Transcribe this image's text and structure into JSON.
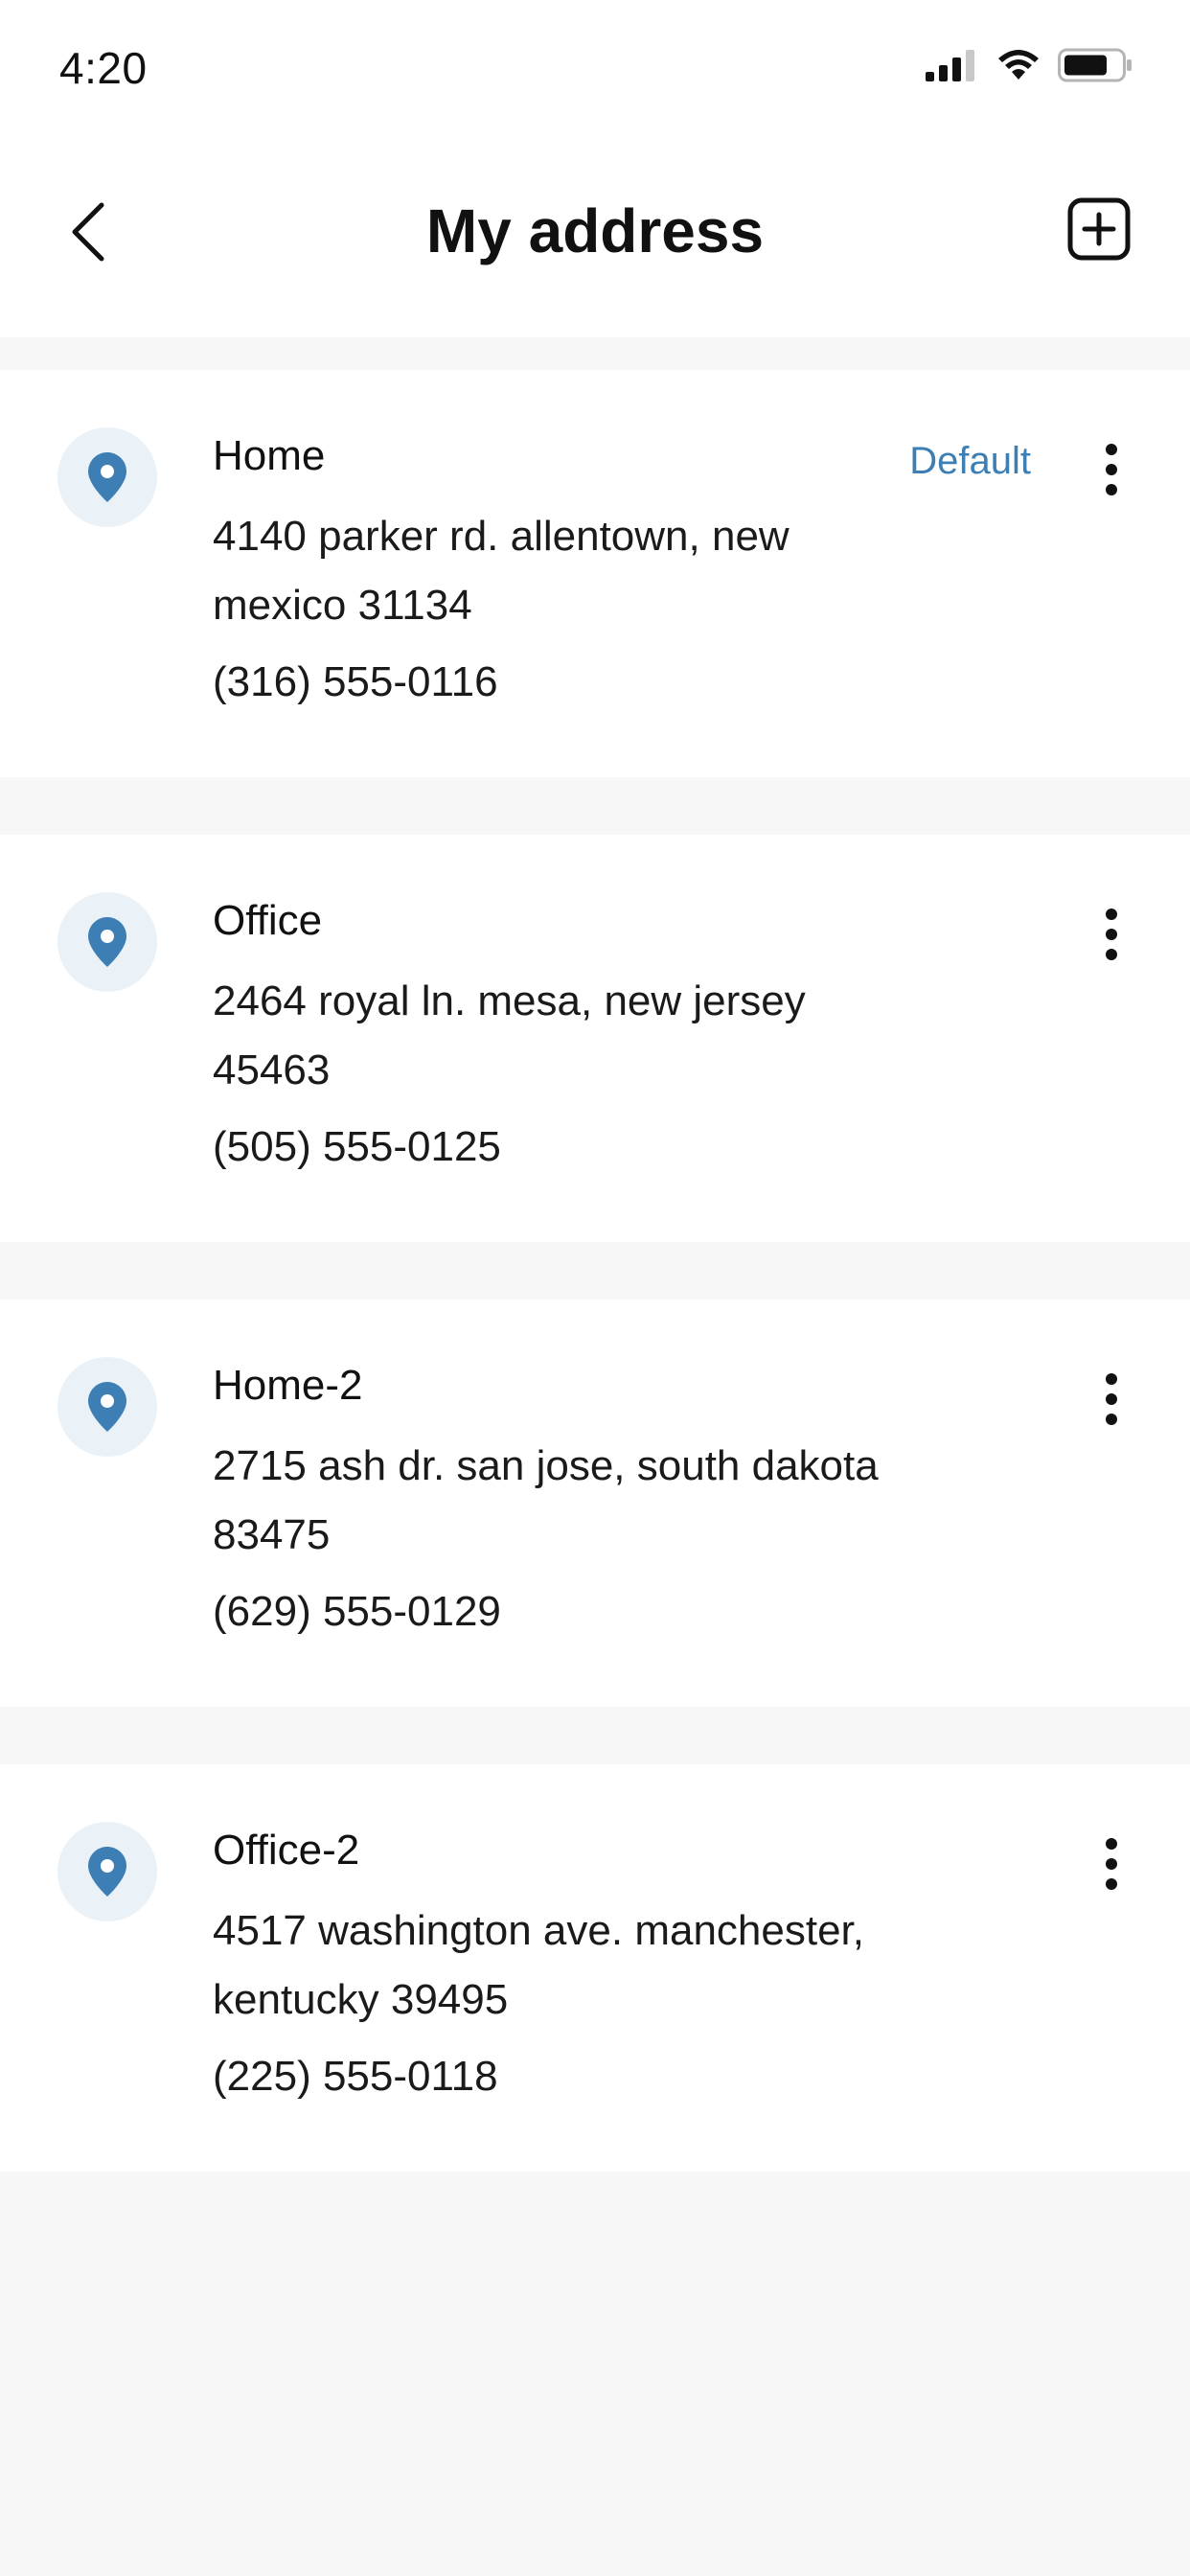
{
  "status_bar": {
    "time": "4:20"
  },
  "header": {
    "title": "My address"
  },
  "colors": {
    "accent": "#3d7fb5",
    "pin_bg": "#eaf1f7",
    "page_bg": "#f7f7f7"
  },
  "addresses": [
    {
      "label": "Home",
      "address": "4140 parker rd. allentown, new mexico 31134",
      "phone": "(316) 555-0116",
      "badge": "Default"
    },
    {
      "label": "Office",
      "address": "2464 royal ln. mesa, new jersey 45463",
      "phone": "(505) 555-0125"
    },
    {
      "label": "Home-2",
      "address": "2715 ash dr. san jose, south dakota 83475",
      "phone": "(629) 555-0129"
    },
    {
      "label": "Office-2",
      "address": "4517 washington ave. manchester, kentucky 39495",
      "phone": "(225) 555-0118"
    }
  ]
}
